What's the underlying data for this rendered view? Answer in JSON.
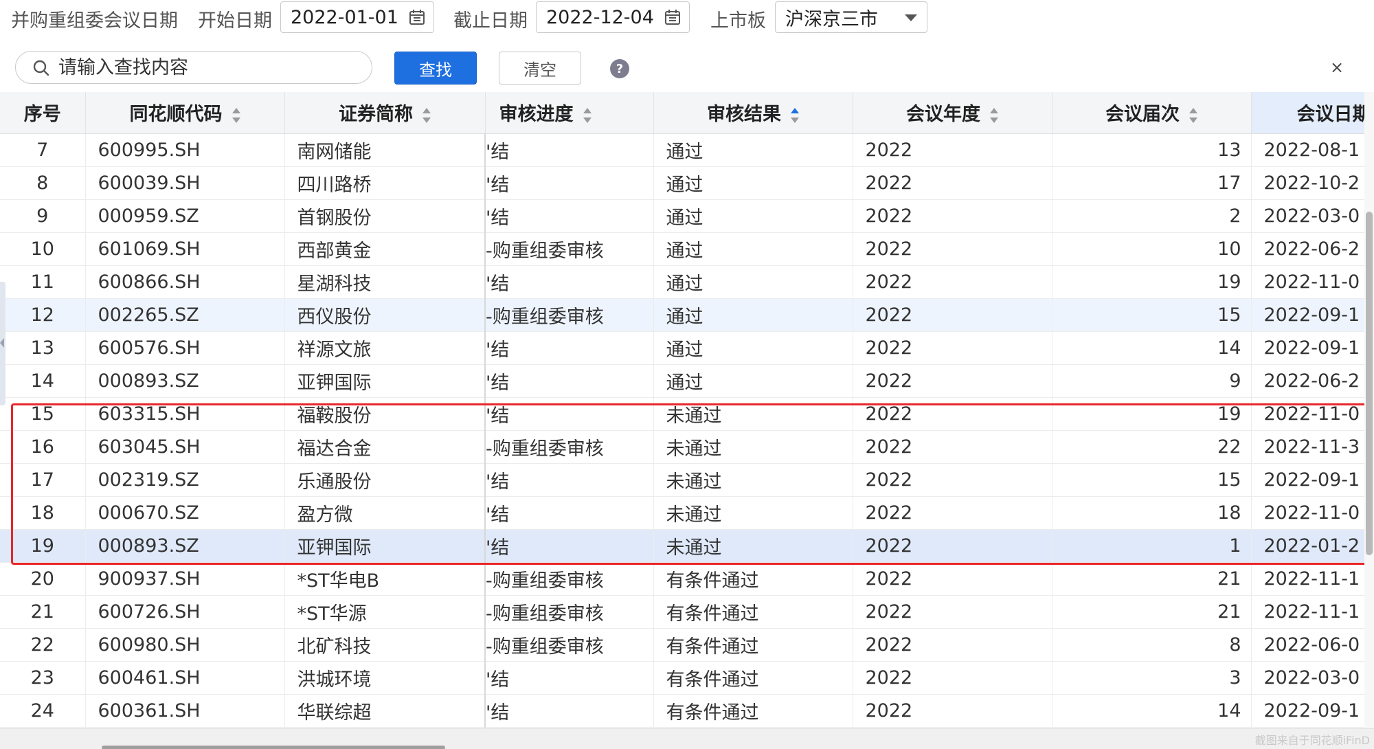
{
  "filter": {
    "title": "并购重组委会议日期",
    "start_label": "开始日期",
    "start_value": "2022-01-01",
    "end_label": "截止日期",
    "end_value": "2022-12-04",
    "market_label": "上市板",
    "market_value": "沪深京三市"
  },
  "search": {
    "placeholder": "请输入查找内容",
    "search_button": "查找",
    "clear_button": "清空",
    "help": "?",
    "close": "×"
  },
  "table": {
    "columns": [
      "序号",
      "同花顺代码",
      "证券简称",
      "审核进度",
      "审核结果",
      "会议年度",
      "会议届次",
      "会议日期"
    ],
    "rows": [
      {
        "no": "7",
        "code": "600995.SH",
        "name": "南网储能",
        "progress": "'结",
        "result": "通过",
        "year": "2022",
        "session": "13",
        "date": "2022-08-1"
      },
      {
        "no": "8",
        "code": "600039.SH",
        "name": "四川路桥",
        "progress": "'结",
        "result": "通过",
        "year": "2022",
        "session": "17",
        "date": "2022-10-2"
      },
      {
        "no": "9",
        "code": "000959.SZ",
        "name": "首钢股份",
        "progress": "'结",
        "result": "通过",
        "year": "2022",
        "session": "2",
        "date": "2022-03-0"
      },
      {
        "no": "10",
        "code": "601069.SH",
        "name": "西部黄金",
        "progress": "-购重组委审核",
        "result": "通过",
        "year": "2022",
        "session": "10",
        "date": "2022-06-2"
      },
      {
        "no": "11",
        "code": "600866.SH",
        "name": "星湖科技",
        "progress": "'结",
        "result": "通过",
        "year": "2022",
        "session": "19",
        "date": "2022-11-0"
      },
      {
        "no": "12",
        "code": "002265.SZ",
        "name": "西仪股份",
        "progress": "-购重组委审核",
        "result": "通过",
        "year": "2022",
        "session": "15",
        "date": "2022-09-1"
      },
      {
        "no": "13",
        "code": "600576.SH",
        "name": "祥源文旅",
        "progress": "'结",
        "result": "通过",
        "year": "2022",
        "session": "14",
        "date": "2022-09-1"
      },
      {
        "no": "14",
        "code": "000893.SZ",
        "name": "亚钾国际",
        "progress": "'结",
        "result": "通过",
        "year": "2022",
        "session": "9",
        "date": "2022-06-2"
      },
      {
        "no": "15",
        "code": "603315.SH",
        "name": "福鞍股份",
        "progress": "'结",
        "result": "未通过",
        "year": "2022",
        "session": "19",
        "date": "2022-11-0"
      },
      {
        "no": "16",
        "code": "603045.SH",
        "name": "福达合金",
        "progress": "-购重组委审核",
        "result": "未通过",
        "year": "2022",
        "session": "22",
        "date": "2022-11-3"
      },
      {
        "no": "17",
        "code": "002319.SZ",
        "name": "乐通股份",
        "progress": "'结",
        "result": "未通过",
        "year": "2022",
        "session": "15",
        "date": "2022-09-1"
      },
      {
        "no": "18",
        "code": "000670.SZ",
        "name": "盈方微",
        "progress": "'结",
        "result": "未通过",
        "year": "2022",
        "session": "18",
        "date": "2022-11-0"
      },
      {
        "no": "19",
        "code": "000893.SZ",
        "name": "亚钾国际",
        "progress": "'结",
        "result": "未通过",
        "year": "2022",
        "session": "1",
        "date": "2022-01-2"
      },
      {
        "no": "20",
        "code": "900937.SH",
        "name": "*ST华电B",
        "progress": "-购重组委审核",
        "result": "有条件通过",
        "year": "2022",
        "session": "21",
        "date": "2022-11-1"
      },
      {
        "no": "21",
        "code": "600726.SH",
        "name": "*ST华源",
        "progress": "-购重组委审核",
        "result": "有条件通过",
        "year": "2022",
        "session": "21",
        "date": "2022-11-1"
      },
      {
        "no": "22",
        "code": "600980.SH",
        "name": "北矿科技",
        "progress": "-购重组委审核",
        "result": "有条件通过",
        "year": "2022",
        "session": "8",
        "date": "2022-06-0"
      },
      {
        "no": "23",
        "code": "600461.SH",
        "name": "洪城环境",
        "progress": "'结",
        "result": "有条件通过",
        "year": "2022",
        "session": "3",
        "date": "2022-03-0"
      },
      {
        "no": "24",
        "code": "600361.SH",
        "name": "华联综超",
        "progress": "'结",
        "result": "有条件通过",
        "year": "2022",
        "session": "14",
        "date": "2022-09-1"
      }
    ]
  },
  "watermark": "截图来自于同花顺iFinD",
  "colors": {
    "primary_button": "#1e6fe0",
    "highlight_box": "#e8262b",
    "selected_row": "#dfe9f9"
  }
}
